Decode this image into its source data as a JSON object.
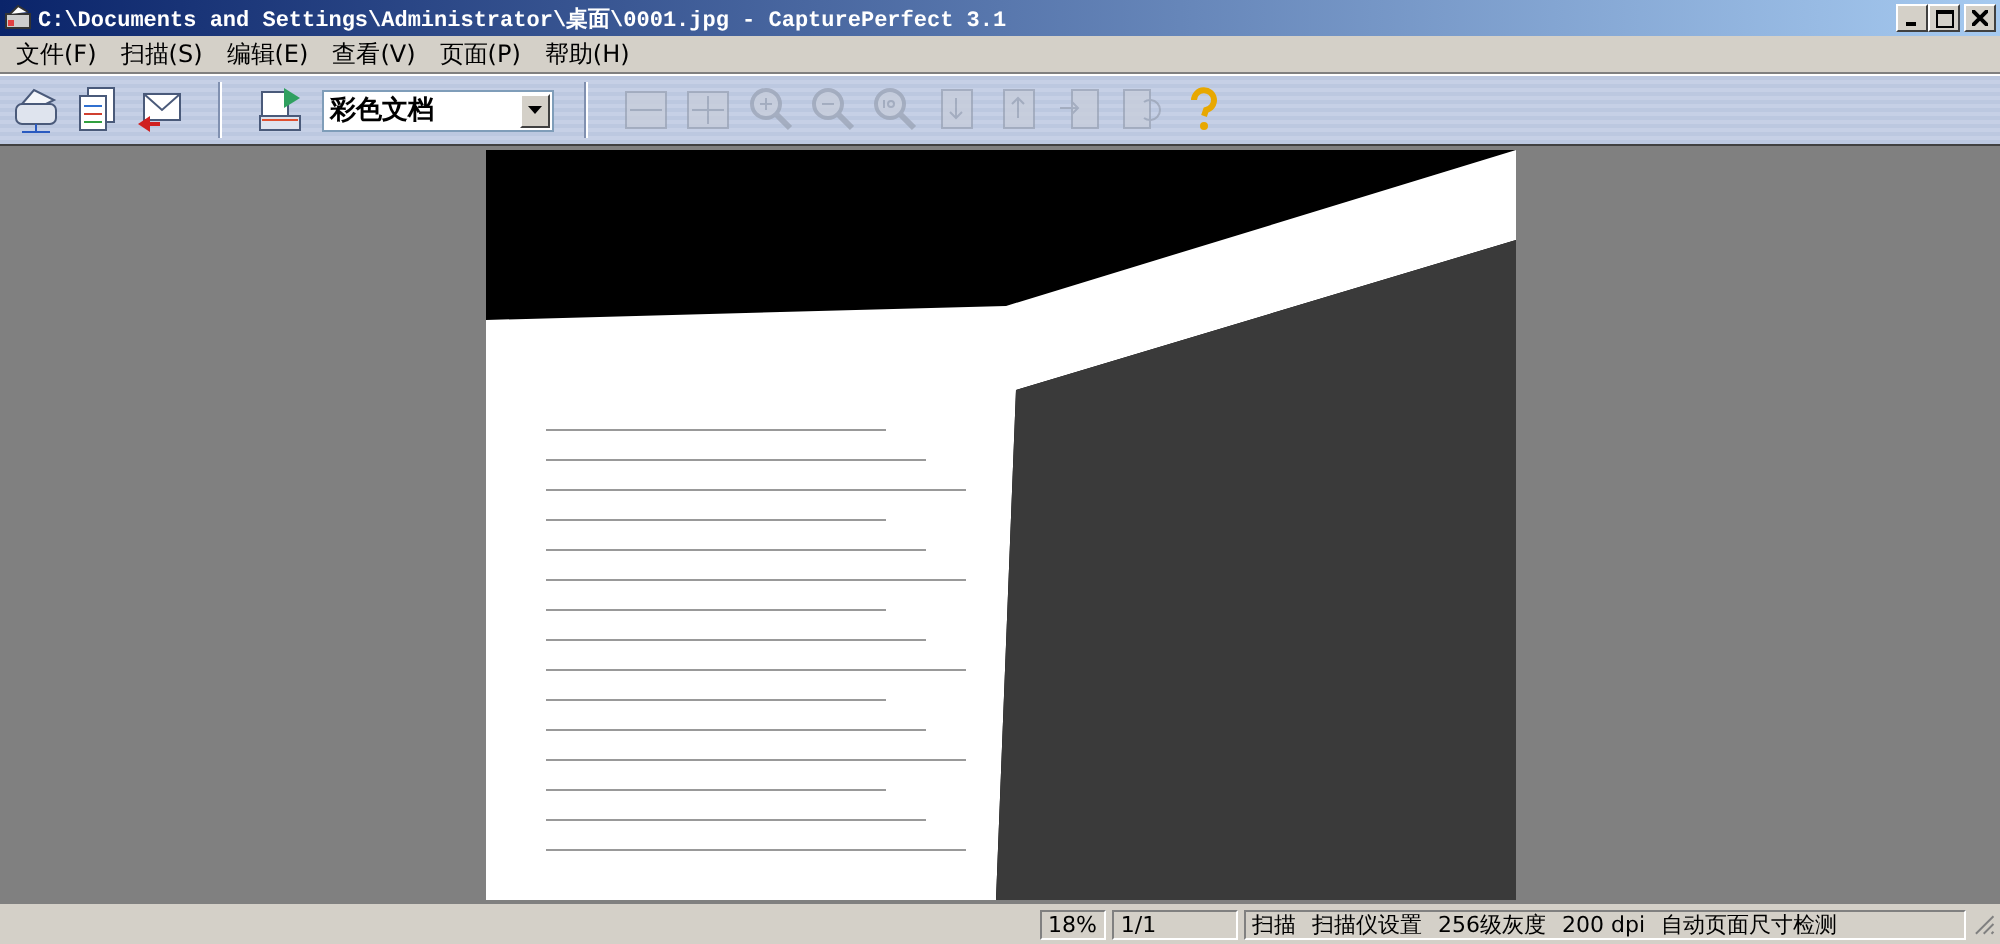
{
  "window": {
    "title": "C:\\Documents and Settings\\Administrator\\桌面\\0001.jpg - CapturePerfect 3.1"
  },
  "menu": [
    "文件(F)",
    "扫描(S)",
    "编辑(E)",
    "查看(V)",
    "页面(P)",
    "帮助(H)"
  ],
  "toolbar": {
    "left_tools": [
      {
        "kind": "scanner",
        "disabled": false
      },
      {
        "kind": "pages",
        "disabled": false
      },
      {
        "kind": "email",
        "disabled": false
      }
    ],
    "scan_tool": {
      "kind": "scan",
      "disabled": false
    },
    "mode_select": {
      "value": "彩色文档"
    },
    "right_tools": [
      {
        "kind": "fit-width",
        "disabled": true
      },
      {
        "kind": "fit-page",
        "disabled": true
      },
      {
        "kind": "zoom-in",
        "disabled": true
      },
      {
        "kind": "zoom-out",
        "disabled": true
      },
      {
        "kind": "zoom-100",
        "disabled": true
      },
      {
        "kind": "page-down",
        "disabled": true
      },
      {
        "kind": "page-up",
        "disabled": true
      },
      {
        "kind": "page-insert",
        "disabled": true
      },
      {
        "kind": "page-replace",
        "disabled": true
      },
      {
        "kind": "help",
        "disabled": false
      }
    ]
  },
  "status_bar": {
    "zoom": "18%",
    "page": "1/1",
    "settings": [
      "扫描",
      "扫描仪设置",
      "256级灰度",
      "200 dpi",
      "自动页面尺寸检测"
    ]
  }
}
